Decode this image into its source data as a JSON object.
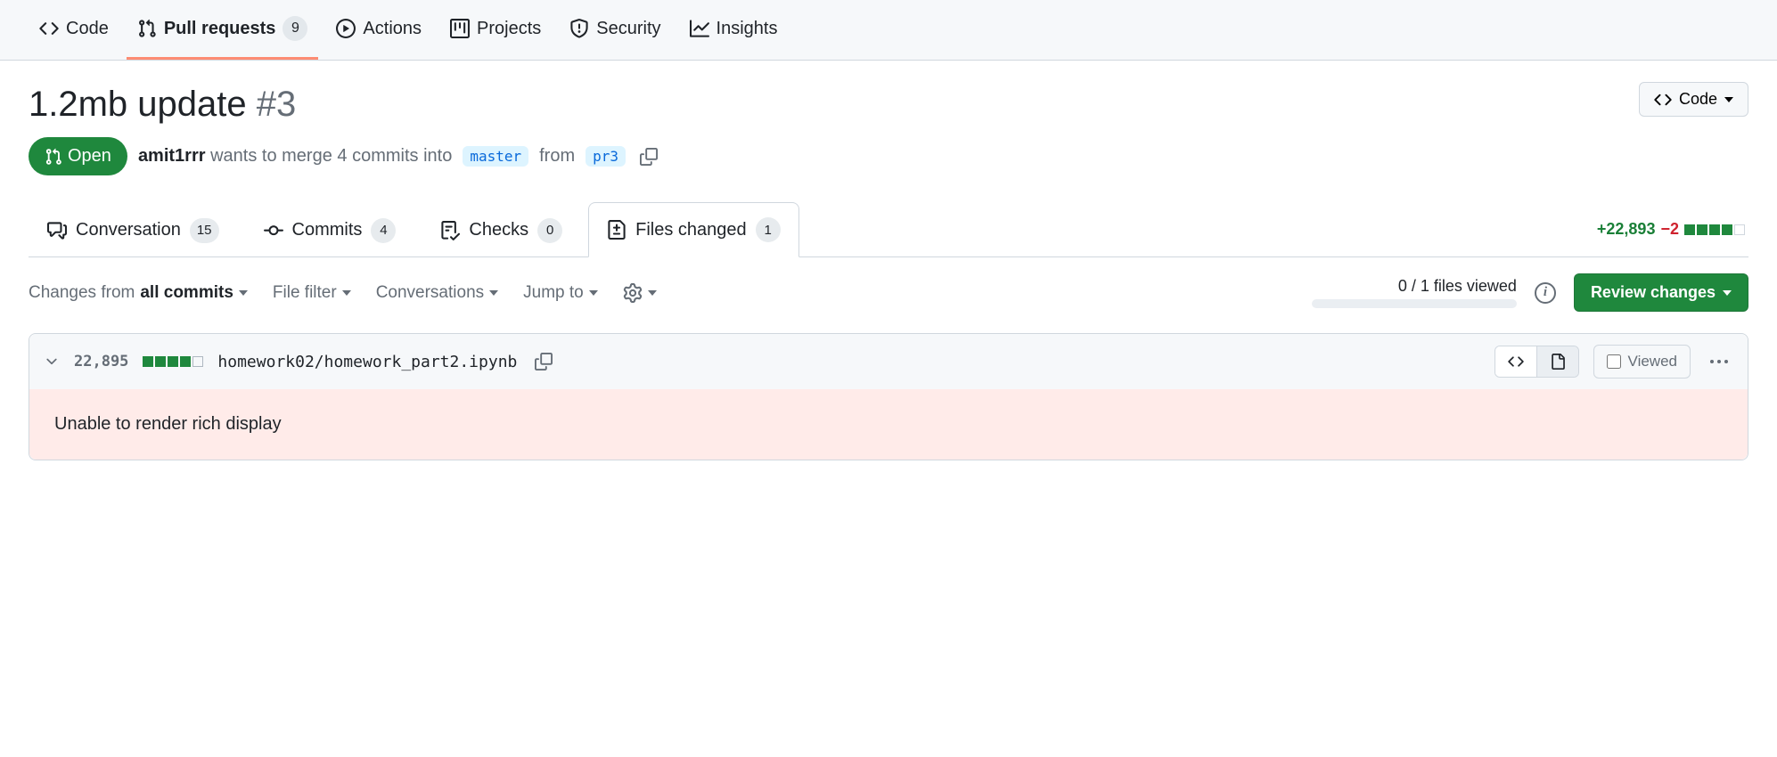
{
  "repo_nav": {
    "code": "Code",
    "pull_requests": "Pull requests",
    "pull_requests_count": "9",
    "actions": "Actions",
    "projects": "Projects",
    "security": "Security",
    "insights": "Insights"
  },
  "pr": {
    "title": "1.2mb update",
    "number": "#3",
    "state": "Open",
    "author": "amit1rrr",
    "merge_text_1": "wants to merge 4 commits into",
    "base_branch": "master",
    "merge_text_2": "from",
    "head_branch": "pr3"
  },
  "code_button": "Code",
  "pr_tabs": {
    "conversation": "Conversation",
    "conversation_count": "15",
    "commits": "Commits",
    "commits_count": "4",
    "checks": "Checks",
    "checks_count": "0",
    "files_changed": "Files changed",
    "files_changed_count": "1"
  },
  "diffstat": {
    "additions": "+22,893",
    "deletions": "−2"
  },
  "toolbar": {
    "changes_from_prefix": "Changes from ",
    "changes_from_value": "all commits",
    "file_filter": "File filter",
    "conversations": "Conversations",
    "jump_to": "Jump to",
    "files_viewed": "0 / 1 files viewed",
    "review_changes": "Review changes"
  },
  "file": {
    "changes": "22,895",
    "path": "homework02/homework_part2.ipynb",
    "viewed_label": "Viewed",
    "error": "Unable to render rich display"
  }
}
